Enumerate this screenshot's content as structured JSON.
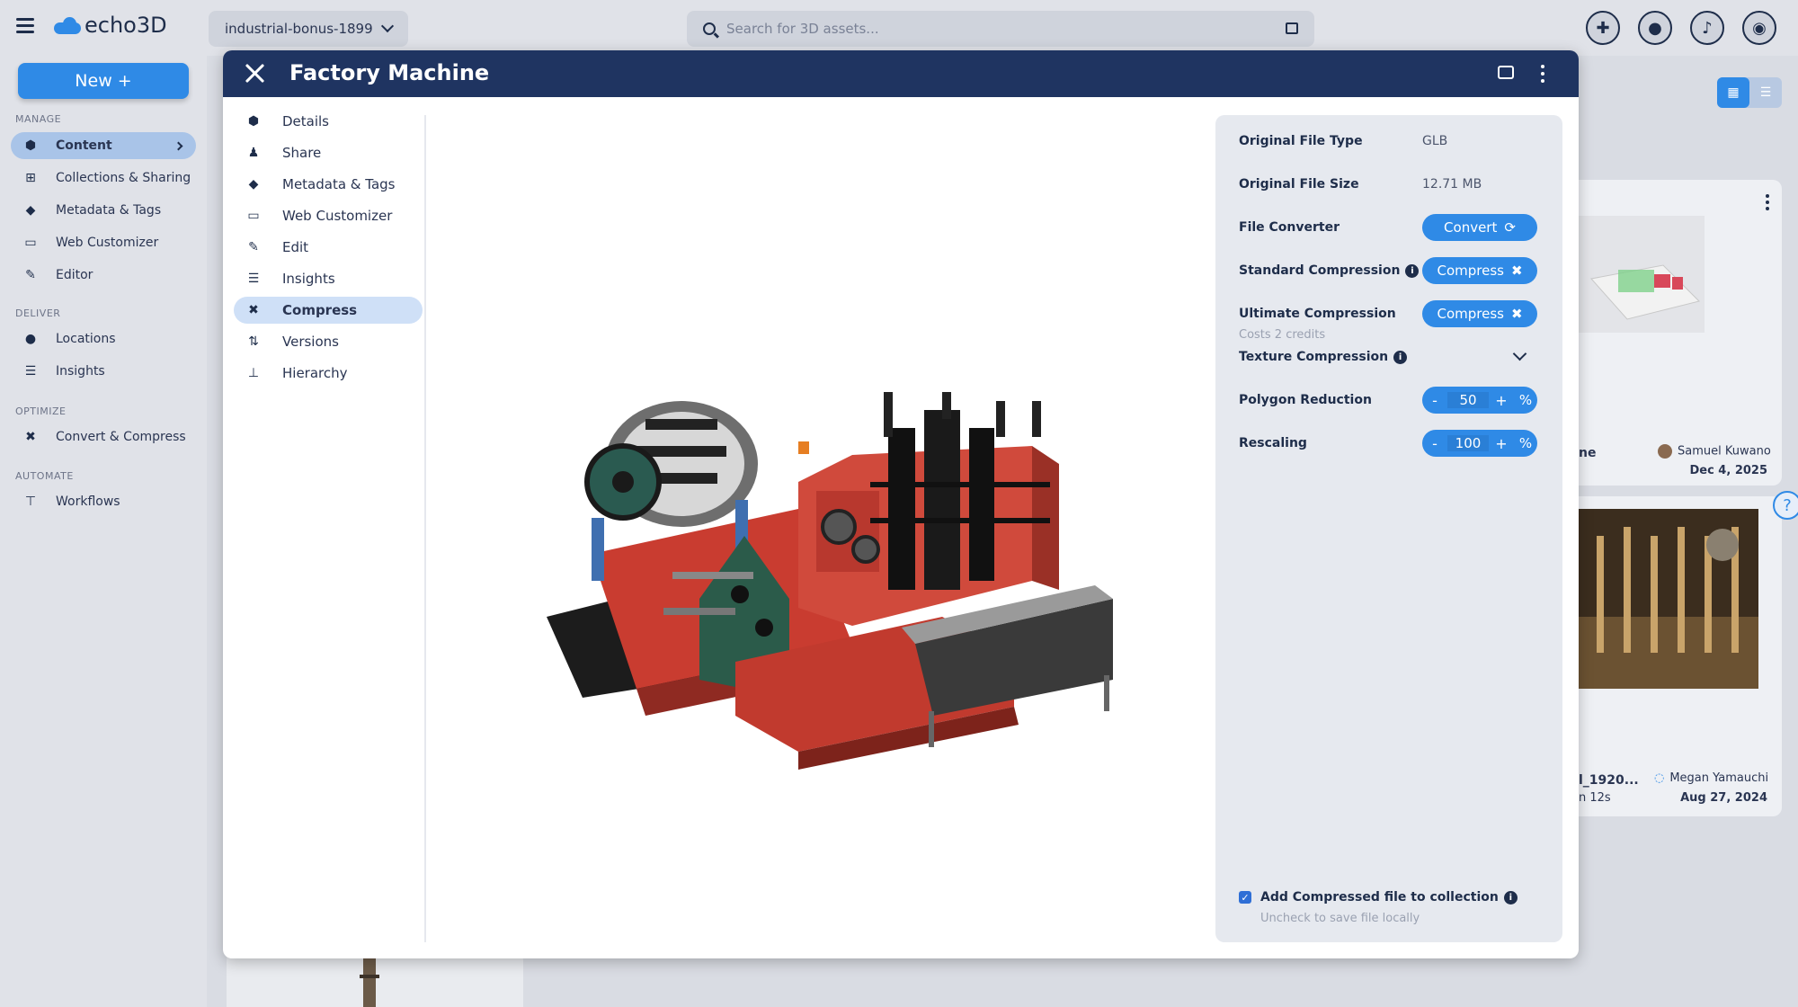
{
  "app": {
    "name": "echo3D",
    "project": "industrial-bonus-1899"
  },
  "search": {
    "placeholder": "Search for 3D assets..."
  },
  "sidebar": {
    "new_label": "New +",
    "sections": {
      "manage": "MANAGE",
      "deliver": "DELIVER",
      "optimize": "OPTIMIZE",
      "automate": "AUTOMATE"
    },
    "items": [
      {
        "label": "Content",
        "icon": "cube-icon"
      },
      {
        "label": "Collections & Sharing",
        "icon": "grid-icon"
      },
      {
        "label": "Metadata & Tags",
        "icon": "tag-icon"
      },
      {
        "label": "Web Customizer",
        "icon": "vr-glasses-icon"
      },
      {
        "label": "Editor",
        "icon": "pencil-icon"
      },
      {
        "label": "Locations",
        "icon": "location-pin-icon"
      },
      {
        "label": "Insights",
        "icon": "chart-icon"
      },
      {
        "label": "Convert & Compress",
        "icon": "compress-icon"
      },
      {
        "label": "Workflows",
        "icon": "workflow-icon"
      }
    ]
  },
  "background_cards": {
    "card1": {
      "name_fragment": "ne",
      "author": "Samuel Kuwano",
      "date": "Dec 4, 2025"
    },
    "card2": {
      "name_fragment": "l_1920...",
      "duration_fragment": "n 12s",
      "author": "Megan Yamauchi",
      "date": "Aug 27, 2024"
    }
  },
  "modal": {
    "title": "Factory Machine",
    "nav": [
      {
        "label": "Details",
        "icon": "cube-icon"
      },
      {
        "label": "Share",
        "icon": "user-plus-icon"
      },
      {
        "label": "Metadata & Tags",
        "icon": "tag-icon"
      },
      {
        "label": "Web Customizer",
        "icon": "vr-glasses-icon"
      },
      {
        "label": "Edit",
        "icon": "pencil-icon"
      },
      {
        "label": "Insights",
        "icon": "chart-icon"
      },
      {
        "label": "Compress",
        "icon": "compress-icon",
        "active": true
      },
      {
        "label": "Versions",
        "icon": "versions-icon"
      },
      {
        "label": "Hierarchy",
        "icon": "hierarchy-icon"
      }
    ],
    "panel": {
      "original_file_type_label": "Original File Type",
      "original_file_type": "GLB",
      "original_file_size_label": "Original File Size",
      "original_file_size": "12.71 MB",
      "file_converter_label": "File Converter",
      "convert_button": "Convert",
      "standard_compression_label": "Standard Compression",
      "standard_compress_button": "Compress",
      "ultimate_compression_label": "Ultimate Compression",
      "ultimate_compression_sub": "Costs 2 credits",
      "ultimate_compress_button": "Compress",
      "texture_compression_label": "Texture Compression",
      "polygon_reduction_label": "Polygon Reduction",
      "polygon_reduction_value": "50",
      "rescaling_label": "Rescaling",
      "rescaling_value": "100",
      "percent_symbol": "%",
      "minus_symbol": "-",
      "plus_symbol": "+",
      "add_to_collection_label": "Add Compressed file to collection",
      "add_to_collection_sub": "Uncheck to save file locally",
      "add_to_collection_checked": true
    }
  },
  "colors": {
    "accent": "#2f8ae6",
    "header": "#1f3461",
    "active_nav": "#cfe0f7"
  }
}
